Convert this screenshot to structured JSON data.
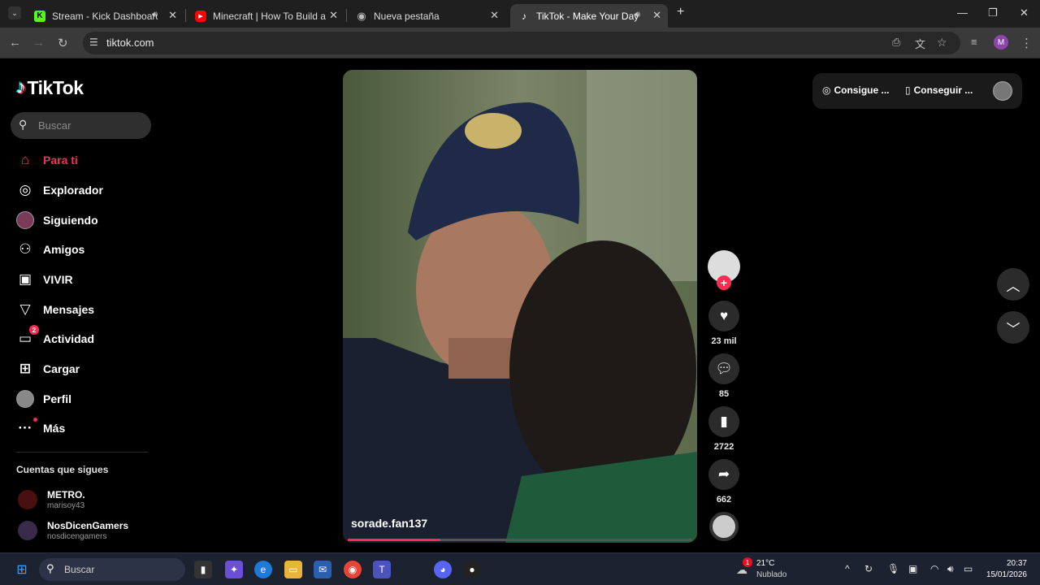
{
  "browser": {
    "tabs": [
      {
        "title": "Stream - Kick Dashboard",
        "favicon": "kick-icon",
        "audio": true
      },
      {
        "title": "Minecraft | How To Build a Fore",
        "favicon": "youtube-icon",
        "audio": false
      },
      {
        "title": "Nueva pestaña",
        "favicon": "chrome-icon",
        "audio": false
      },
      {
        "title": "TikTok - Make Your Day",
        "favicon": "tiktok-icon",
        "audio": true,
        "active": true
      }
    ],
    "url": "tiktok.com",
    "profile_initial": "M"
  },
  "tiktok": {
    "logo_text": "TikTok",
    "search_placeholder": "Buscar",
    "nav": [
      {
        "label": "Para ti",
        "icon": "home-icon",
        "active": true
      },
      {
        "label": "Explorador",
        "icon": "compass-icon"
      },
      {
        "label": "Siguiendo",
        "icon": "following-avatar-icon"
      },
      {
        "label": "Amigos",
        "icon": "friends-icon"
      },
      {
        "label": "VIVIR",
        "icon": "live-icon"
      },
      {
        "label": "Mensajes",
        "icon": "send-icon"
      },
      {
        "label": "Actividad",
        "icon": "inbox-icon",
        "badge": "2"
      },
      {
        "label": "Cargar",
        "icon": "upload-icon"
      },
      {
        "label": "Perfil",
        "icon": "profile-avatar-icon"
      },
      {
        "label": "Más",
        "icon": "more-icon"
      }
    ],
    "following_heading": "Cuentas que sigues",
    "following": [
      {
        "name": "METRO.",
        "handle": "marisoy43"
      },
      {
        "name": "NosDicenGamers",
        "handle": "nosdicengamers"
      }
    ],
    "video": {
      "username": "sorade.fan137",
      "progress": 0.27
    },
    "actions": {
      "likes": "23 mil",
      "comments": "85",
      "saves": "2722",
      "shares": "662"
    },
    "top_right": {
      "coins_label": "Consigue ...",
      "app_label": "Conseguir ..."
    }
  },
  "taskbar": {
    "search_placeholder": "Buscar",
    "weather_temp": "21°C",
    "weather_cond": "Nublado",
    "weather_badge": "1",
    "time": "20:37",
    "date": "15/01/2026"
  },
  "colors": {
    "accent": "#fe2c55",
    "bg": "#000000"
  }
}
